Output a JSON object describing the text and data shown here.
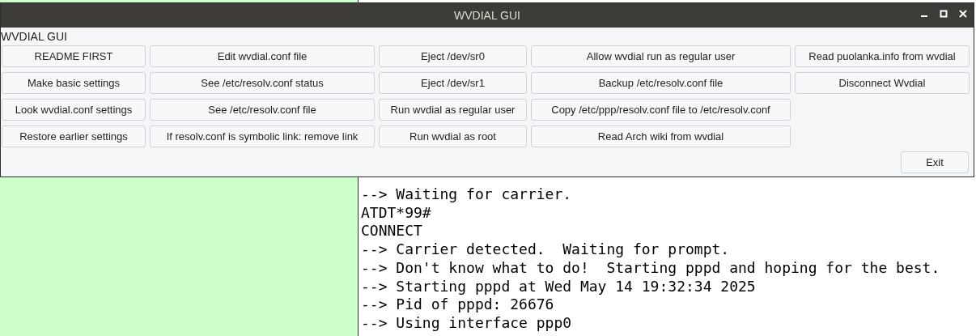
{
  "window": {
    "title": "WVDIAL GUI",
    "label": "WVDIAL GUI"
  },
  "button_rows": [
    [
      "README FIRST",
      "Edit wvdial.conf file",
      "Eject /dev/sr0",
      "Allow wvdial run as regular user",
      "Read puolanka.info from wvdial"
    ],
    [
      "Make basic settings",
      "See /etc/resolv.conf status",
      "Eject /dev/sr1",
      "Backup /etc/resolv.conf file",
      "Disconnect Wvdial"
    ],
    [
      "Look wvdial.conf settings",
      "See /etc/resolv.conf file",
      "Run wvdial as regular user",
      "Copy /etc/ppp/resolv.conf file to /etc/resolv.conf"
    ],
    [
      "Restore earlier settings",
      "If resolv.conf is symbolic link: remove link",
      "Run wvdial as root",
      "Read Arch wiki from wvdial"
    ]
  ],
  "exit_button": "Exit",
  "terminal_lines": [
    "--> Waiting for carrier.",
    "ATDT*99#",
    "CONNECT",
    "--> Carrier detected.  Waiting for prompt.",
    "--> Don't know what to do!  Starting pppd and hoping for the best.",
    "--> Starting pppd at Wed May 14 19:32:34 2025",
    "--> Pid of pppd: 26676",
    "--> Using interface ppp0"
  ]
}
